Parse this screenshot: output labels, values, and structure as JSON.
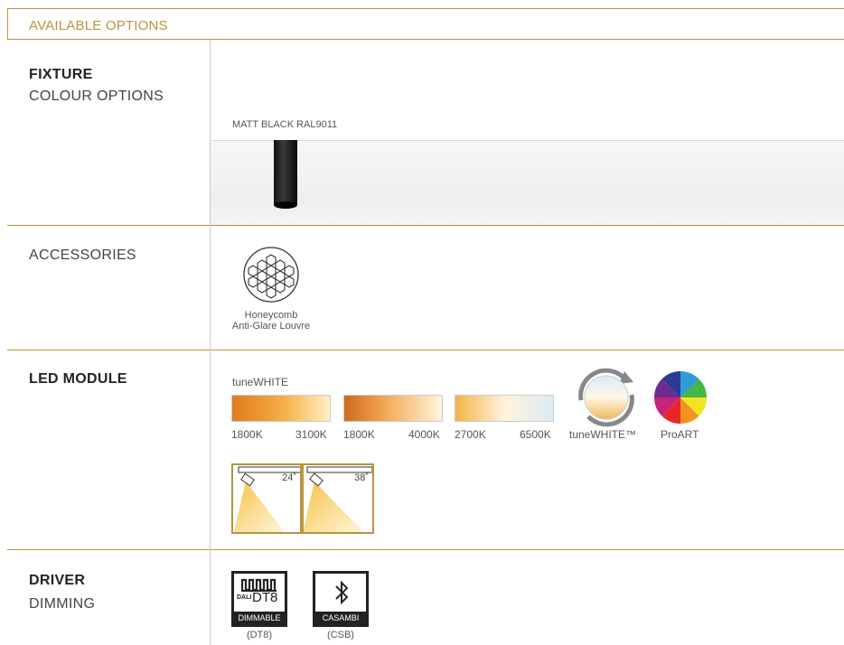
{
  "header": {
    "title": "AVAILABLE OPTIONS"
  },
  "fixture": {
    "title": "FIXTURE",
    "subtitle": "COLOUR OPTIONS",
    "colour_label": "MATT BLACK RAL9011"
  },
  "accessories": {
    "title": "ACCESSORIES",
    "item_label_1": "Honeycomb",
    "item_label_2": "Anti-Glare Louvre"
  },
  "led": {
    "title": "LED MODULE",
    "tunewhite_title": "tuneWHITE",
    "ranges": [
      {
        "start": "1800K",
        "end": "3100K"
      },
      {
        "start": "1800K",
        "end": "4000K"
      },
      {
        "start": "2700K",
        "end": "6500K"
      }
    ],
    "tunewhite_icon_label": "tuneWHITE™",
    "proart_label": "ProART",
    "beam_angles": [
      "24˚",
      "38˚"
    ]
  },
  "driver": {
    "title": "DRIVER",
    "subtitle": "DIMMING",
    "dali_text": "DT8",
    "dali_prefix": "DALI",
    "dt8_bar": "DIMMABLE",
    "dt8_caption": "(DT8)",
    "casambi_bar": "CASAMBI",
    "casambi_caption": "(CSB)"
  },
  "colors": {
    "gold": "#b8953f",
    "line": "#c8c8c8"
  }
}
